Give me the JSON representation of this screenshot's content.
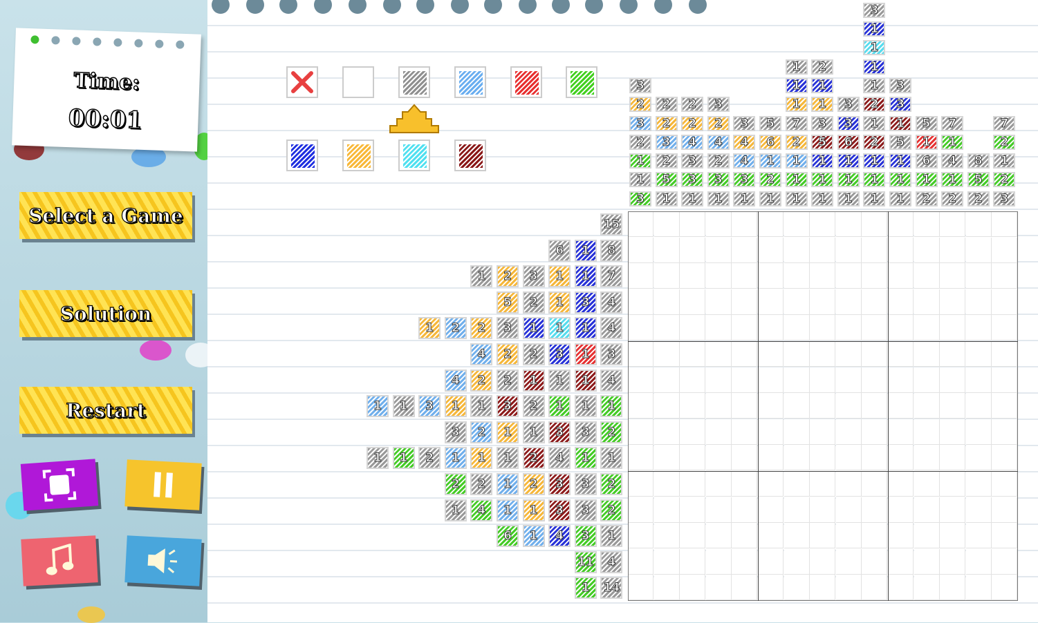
{
  "timer": {
    "label": "Time:",
    "value": "00:01"
  },
  "menu": {
    "select_game": "Select a Game",
    "solution": "Solution",
    "restart": "Restart"
  },
  "icons": {
    "fullscreen": "fullscreen-icon",
    "pause": "pause-icon",
    "music": "music-icon",
    "sound": "speaker-icon"
  },
  "palette": {
    "colors": [
      {
        "name": "cross",
        "color": "#e84040"
      },
      {
        "name": "empty",
        "color": "#ffffff"
      },
      {
        "name": "gray",
        "color": "#909090"
      },
      {
        "name": "lightblue",
        "color": "#6aaef0"
      },
      {
        "name": "red",
        "color": "#e83030"
      },
      {
        "name": "green",
        "color": "#44d020"
      },
      {
        "name": "blue",
        "color": "#2030e0"
      },
      {
        "name": "orange",
        "color": "#f8b838"
      },
      {
        "name": "cyan",
        "color": "#50e0f0"
      },
      {
        "name": "darkred",
        "color": "#8a1818"
      }
    ],
    "selected": "gray"
  },
  "color_map": {
    "g": "#9a9a9a",
    "lb": "#72b0ec",
    "r": "#e63434",
    "gr": "#46cc28",
    "b": "#2a34d8",
    "o": "#f6b83c",
    "c": "#58dcee",
    "dr": "#8e1e1e"
  },
  "column_clues": [
    [
      [
        "3",
        "g"
      ],
      [
        "2",
        "o"
      ],
      [
        "3",
        "lb"
      ],
      [
        "2",
        "g"
      ],
      [
        "1",
        "gr"
      ],
      [
        "1",
        "g"
      ],
      [
        "3",
        "gr"
      ]
    ],
    [
      [
        "2",
        "g"
      ],
      [
        "2",
        "o"
      ],
      [
        "3",
        "lb"
      ],
      [
        "2",
        "g"
      ],
      [
        "5",
        "gr"
      ],
      [
        "1",
        "g"
      ]
    ],
    [
      [
        "2",
        "g"
      ],
      [
        "2",
        "o"
      ],
      [
        "4",
        "lb"
      ],
      [
        "3",
        "g"
      ],
      [
        "3",
        "gr"
      ],
      [
        "1",
        "g"
      ]
    ],
    [
      [
        "3",
        "g"
      ],
      [
        "2",
        "o"
      ],
      [
        "4",
        "lb"
      ],
      [
        "2",
        "g"
      ],
      [
        "3",
        "gr"
      ],
      [
        "1",
        "g"
      ]
    ],
    [
      [
        "3",
        "g"
      ],
      [
        "4",
        "o"
      ],
      [
        "4",
        "lb"
      ],
      [
        "3",
        "gr"
      ],
      [
        "1",
        "g"
      ]
    ],
    [
      [
        "5",
        "g"
      ],
      [
        "6",
        "o"
      ],
      [
        "1",
        "lb"
      ],
      [
        "2",
        "gr"
      ],
      [
        "1",
        "g"
      ]
    ],
    [
      [
        "1",
        "g"
      ],
      [
        "1",
        "b"
      ],
      [
        "1",
        "o"
      ],
      [
        "7",
        "g"
      ],
      [
        "2",
        "o"
      ],
      [
        "1",
        "lb"
      ],
      [
        "1",
        "gr"
      ],
      [
        "1",
        "g"
      ]
    ],
    [
      [
        "2",
        "g"
      ],
      [
        "1",
        "b"
      ],
      [
        "1",
        "o"
      ],
      [
        "3",
        "g"
      ],
      [
        "5",
        "dr"
      ],
      [
        "1",
        "b"
      ],
      [
        "1",
        "gr"
      ],
      [
        "1",
        "g"
      ]
    ],
    [
      [
        "3",
        "g"
      ],
      [
        "3",
        "b"
      ],
      [
        "6",
        "dr"
      ],
      [
        "1",
        "b"
      ],
      [
        "1",
        "gr"
      ],
      [
        "1",
        "g"
      ]
    ],
    [
      [
        "3",
        "g"
      ],
      [
        "1",
        "b"
      ],
      [
        "1",
        "c"
      ],
      [
        "1",
        "b"
      ],
      [
        "1",
        "g"
      ],
      [
        "2",
        "dr"
      ],
      [
        "1",
        "g"
      ],
      [
        "2",
        "dr"
      ],
      [
        "1",
        "b"
      ],
      [
        "1",
        "gr"
      ],
      [
        "1",
        "g"
      ]
    ],
    [
      [
        "3",
        "g"
      ],
      [
        "3",
        "b"
      ],
      [
        "1",
        "dr"
      ],
      [
        "5",
        "g"
      ],
      [
        "1",
        "b"
      ],
      [
        "1",
        "gr"
      ],
      [
        "1",
        "g"
      ]
    ],
    [
      [
        "5",
        "g"
      ],
      [
        "1",
        "r"
      ],
      [
        "6",
        "g"
      ],
      [
        "1",
        "gr"
      ],
      [
        "2",
        "g"
      ]
    ],
    [
      [
        "7",
        "g"
      ],
      [
        "1",
        "gr"
      ],
      [
        "4",
        "g"
      ],
      [
        "1",
        "gr"
      ],
      [
        "2",
        "g"
      ]
    ],
    [
      [
        "8",
        "g"
      ],
      [
        "5",
        "gr"
      ],
      [
        "2",
        "g"
      ]
    ],
    [
      [
        "7",
        "g"
      ],
      [
        "2",
        "gr"
      ],
      [
        "1",
        "g"
      ],
      [
        "2",
        "gr"
      ],
      [
        "3",
        "g"
      ]
    ]
  ],
  "row_clues": [
    [
      [
        "15",
        "g"
      ]
    ],
    [
      [
        "6",
        "g"
      ],
      [
        "1",
        "b"
      ],
      [
        "8",
        "g"
      ]
    ],
    [
      [
        "1",
        "g"
      ],
      [
        "2",
        "o"
      ],
      [
        "3",
        "g"
      ],
      [
        "1",
        "o"
      ],
      [
        "1",
        "b"
      ],
      [
        "7",
        "g"
      ]
    ],
    [
      [
        "5",
        "o"
      ],
      [
        "2",
        "g"
      ],
      [
        "1",
        "o"
      ],
      [
        "3",
        "b"
      ],
      [
        "4",
        "g"
      ]
    ],
    [
      [
        "1",
        "o"
      ],
      [
        "2",
        "lb"
      ],
      [
        "2",
        "o"
      ],
      [
        "3",
        "g"
      ],
      [
        "1",
        "b"
      ],
      [
        "1",
        "c"
      ],
      [
        "1",
        "b"
      ],
      [
        "4",
        "g"
      ]
    ],
    [
      [
        "4",
        "lb"
      ],
      [
        "2",
        "o"
      ],
      [
        "2",
        "g"
      ],
      [
        "3",
        "b"
      ],
      [
        "1",
        "r"
      ],
      [
        "3",
        "g"
      ]
    ],
    [
      [
        "4",
        "lb"
      ],
      [
        "2",
        "o"
      ],
      [
        "2",
        "g"
      ],
      [
        "1",
        "dr"
      ],
      [
        "1",
        "g"
      ],
      [
        "1",
        "dr"
      ],
      [
        "4",
        "g"
      ]
    ],
    [
      [
        "1",
        "lb"
      ],
      [
        "1",
        "g"
      ],
      [
        "3",
        "lb"
      ],
      [
        "1",
        "o"
      ],
      [
        "1",
        "g"
      ],
      [
        "3",
        "dr"
      ],
      [
        "2",
        "g"
      ],
      [
        "1",
        "gr"
      ],
      [
        "1",
        "g"
      ],
      [
        "1",
        "gr"
      ]
    ],
    [
      [
        "3",
        "g"
      ],
      [
        "2",
        "lb"
      ],
      [
        "1",
        "o"
      ],
      [
        "1",
        "g"
      ],
      [
        "3",
        "dr"
      ],
      [
        "3",
        "g"
      ],
      [
        "2",
        "gr"
      ]
    ],
    [
      [
        "1",
        "g"
      ],
      [
        "1",
        "gr"
      ],
      [
        "2",
        "g"
      ],
      [
        "1",
        "lb"
      ],
      [
        "1",
        "o"
      ],
      [
        "1",
        "g"
      ],
      [
        "2",
        "dr"
      ],
      [
        "4",
        "g"
      ],
      [
        "1",
        "gr"
      ],
      [
        "1",
        "g"
      ]
    ],
    [
      [
        "2",
        "gr"
      ],
      [
        "2",
        "g"
      ],
      [
        "1",
        "lb"
      ],
      [
        "2",
        "o"
      ],
      [
        "3",
        "dr"
      ],
      [
        "3",
        "g"
      ],
      [
        "2",
        "gr"
      ]
    ],
    [
      [
        "1",
        "g"
      ],
      [
        "4",
        "gr"
      ],
      [
        "1",
        "lb"
      ],
      [
        "1",
        "o"
      ],
      [
        "3",
        "dr"
      ],
      [
        "3",
        "g"
      ],
      [
        "2",
        "gr"
      ]
    ],
    [
      [
        "6",
        "gr"
      ],
      [
        "1",
        "lb"
      ],
      [
        "4",
        "b"
      ],
      [
        "3",
        "gr"
      ],
      [
        "1",
        "g"
      ]
    ],
    [
      [
        "11",
        "gr"
      ],
      [
        "4",
        "g"
      ]
    ],
    [
      [
        "1",
        "gr"
      ],
      [
        "14",
        "g"
      ]
    ]
  ]
}
